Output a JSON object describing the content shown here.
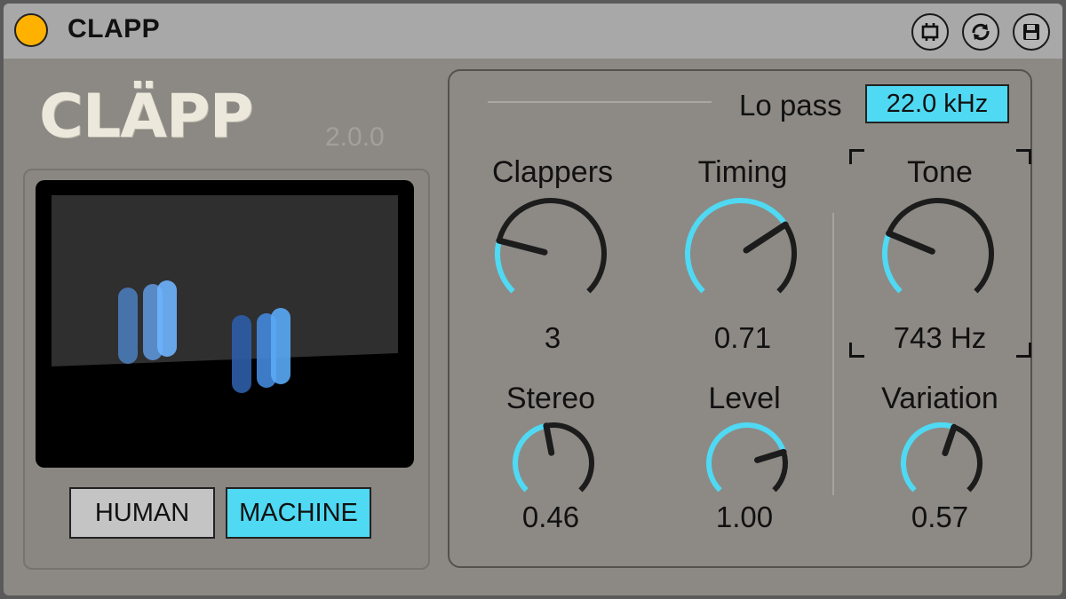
{
  "titlebar": {
    "title": "CLAPP",
    "buttons": [
      {
        "name": "device-map-button",
        "icon": "bracket-icon"
      },
      {
        "name": "hot-swap-button",
        "icon": "refresh-icon"
      },
      {
        "name": "save-preset-button",
        "icon": "floppy-icon"
      }
    ]
  },
  "logo": "CLÄPP",
  "version": "2.0.0",
  "mode": {
    "human_label": "HUMAN",
    "machine_label": "MACHINE",
    "selected": "MACHINE"
  },
  "lopass": {
    "label": "Lo pass",
    "value": "22.0 kHz"
  },
  "colors": {
    "accent": "#4fd9f3",
    "power": "#ffb100",
    "knob_track": "#1c1c1c"
  },
  "knobs": [
    {
      "id": "clappers",
      "label": "Clappers",
      "value_text": "3",
      "level": 0.22
    },
    {
      "id": "timing",
      "label": "Timing",
      "value_text": "0.71",
      "level": 0.71
    },
    {
      "id": "tone",
      "label": "Tone",
      "value_text": "743 Hz",
      "level": 0.25
    },
    {
      "id": "stereo",
      "label": "Stereo",
      "value_text": "0.46",
      "level": 0.46
    },
    {
      "id": "level",
      "label": "Level",
      "value_text": "1.00",
      "level": 0.77
    },
    {
      "id": "variation",
      "label": "Variation",
      "value_text": "0.57",
      "level": 0.57
    }
  ]
}
